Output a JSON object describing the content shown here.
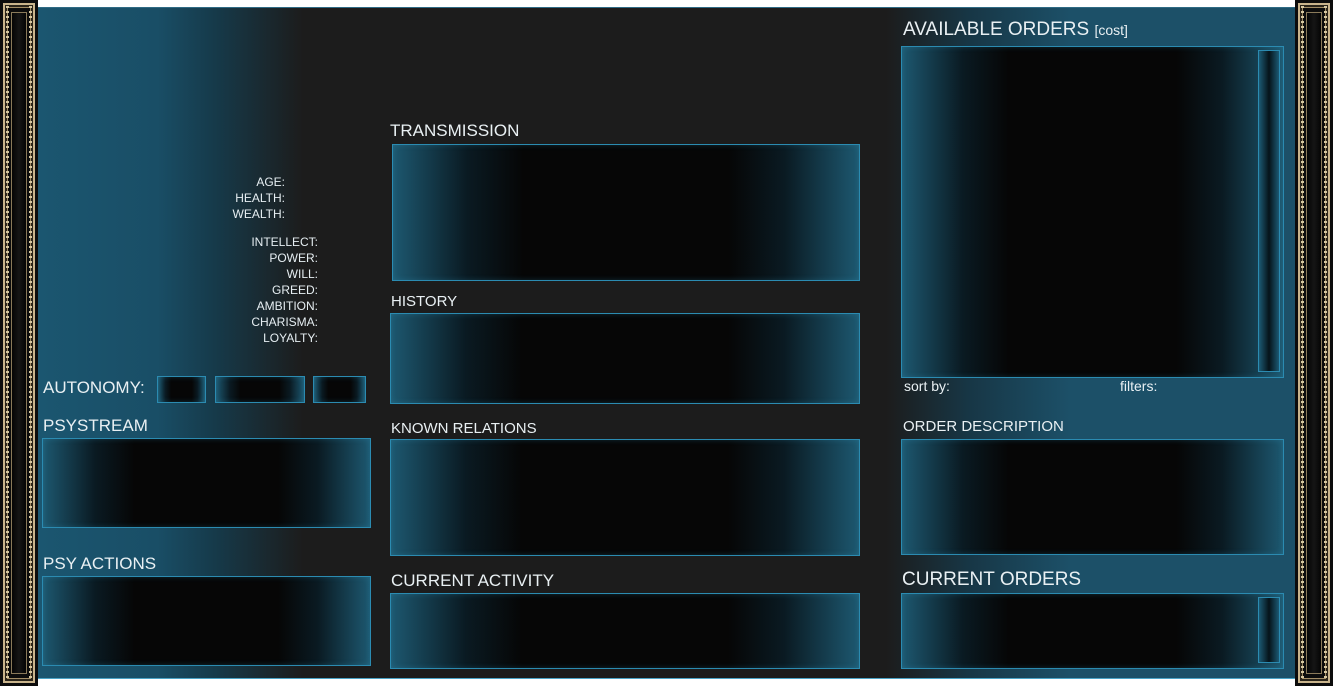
{
  "stats_basic": [
    {
      "label": "AGE:"
    },
    {
      "label": "HEALTH:"
    },
    {
      "label": "WEALTH:"
    }
  ],
  "stats_traits": [
    {
      "label": "INTELLECT:"
    },
    {
      "label": "POWER:"
    },
    {
      "label": "WILL:"
    },
    {
      "label": "GREED:"
    },
    {
      "label": "AMBITION:"
    },
    {
      "label": "CHARISMA:"
    },
    {
      "label": "LOYALTY:"
    }
  ],
  "autonomy": {
    "label": "AUTONOMY:"
  },
  "psystream": {
    "title": "PSYSTREAM"
  },
  "psy_actions": {
    "title": "PSY ACTIONS"
  },
  "transmission": {
    "title": "TRANSMISSION"
  },
  "history": {
    "title": "HISTORY"
  },
  "known_relations": {
    "title": "KNOWN RELATIONS"
  },
  "current_activity": {
    "title": "CURRENT ACTIVITY"
  },
  "available_orders": {
    "title": "AVAILABLE ORDERS",
    "cost_label": "[cost]",
    "sort_label": "sort by:",
    "filters_label": "filters:"
  },
  "order_description": {
    "title": "ORDER DESCRIPTION"
  },
  "current_orders": {
    "title": "CURRENT ORDERS"
  },
  "colors": {
    "panel_border": "#2b8bb1",
    "teal_bg": "#1c5068",
    "dark_bg": "#1c1c1c",
    "frame_gold": "#c9b48c"
  }
}
